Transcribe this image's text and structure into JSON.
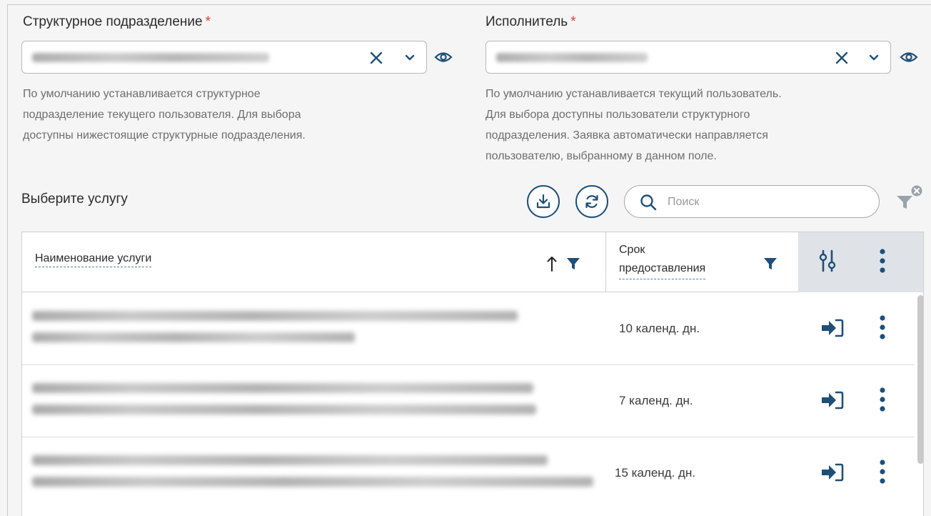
{
  "department": {
    "label": "Структурное подразделение",
    "required_mark": "*",
    "hint_lines": [
      "По умолчанию устанавливается структурное",
      "подразделение текущего пользователя. Для выбора",
      "доступны нижестоящие структурные подразделения."
    ]
  },
  "executor": {
    "label": "Исполнитель",
    "required_mark": "*",
    "hint_lines": [
      "По умолчанию устанавливается текущий пользователь.",
      "Для выбора доступны пользователи структурного",
      "подразделения. Заявка автоматически направляется",
      "пользователю, выбранному в данном поле."
    ]
  },
  "services": {
    "title": "Выберите услугу",
    "search_placeholder": "Поиск",
    "columns": {
      "name": "Наименование услуги",
      "term_line1": "Срок",
      "term_line2": "предоставления"
    },
    "rows": [
      {
        "term": "10 календ. дн."
      },
      {
        "term": "7 календ. дн."
      },
      {
        "term": "15 календ. дн."
      }
    ]
  },
  "colors": {
    "accent": "#1e4f79",
    "required": "#e53935",
    "header_settings_bg": "#dfe3e8"
  }
}
